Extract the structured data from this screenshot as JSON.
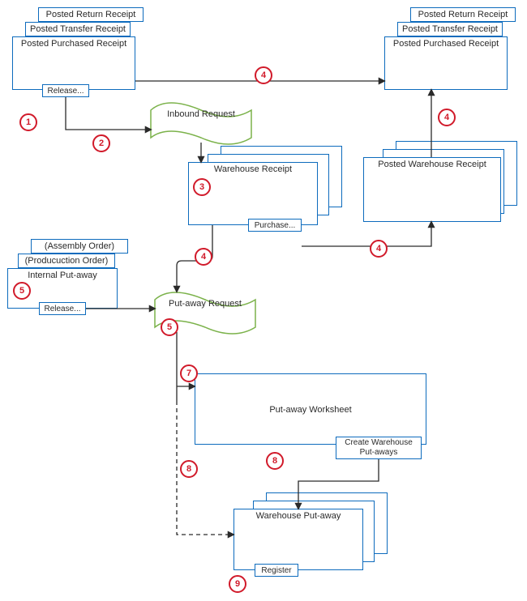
{
  "labels": {
    "posted_return_receipt": "Posted Return  Receipt",
    "posted_transfer_receipt": "Posted Transfer Receipt",
    "posted_purchased_receipt": "Posted Purchased Receipt",
    "release": "Release...",
    "inbound_request": "Inbound Request",
    "warehouse_receipt": "Warehouse Receipt",
    "purchase": "Purchase...",
    "posted_warehouse_receipt": "Posted Warehouse Receipt",
    "assembly_order": "(Assembly Order)",
    "production_order": "(Producuction Order)",
    "internal_put_away": "Internal Put-away",
    "put_away_request": "Put-away Request",
    "put_away_worksheet": "Put-away Worksheet",
    "create_whse_put_aways_l1": "Create Warehouse",
    "create_whse_put_aways_l2": "Put-aways",
    "warehouse_put_away": "Warehouse Put-away",
    "register": "Register"
  },
  "steps": {
    "s1": "1",
    "s2": "2",
    "s3": "3",
    "s4": "4",
    "s5": "5",
    "s7": "7",
    "s8": "8",
    "s9": "9"
  },
  "colors": {
    "stroke": "#0d6bbd",
    "wavy": "#7bb24a",
    "arrow": "#2a2a2a",
    "step_ring": "#d11a2a"
  }
}
